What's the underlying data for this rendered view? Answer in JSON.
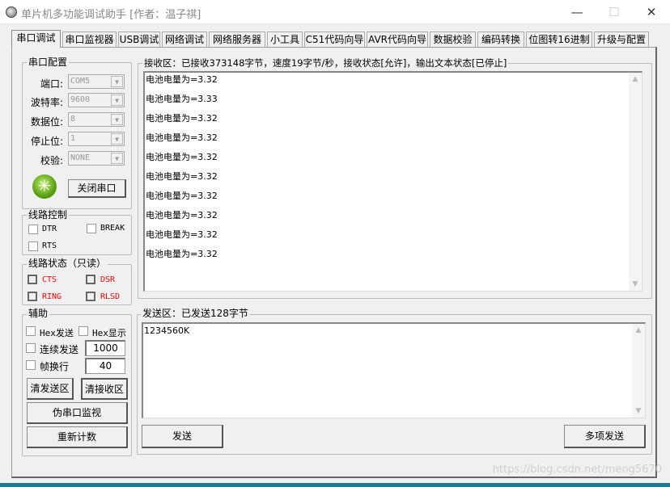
{
  "window": {
    "title": "单片机多功能调试助手 [作者：温子祺]",
    "minimize": "—",
    "maximize": "☐",
    "close": "✕"
  },
  "tabs": [
    "串口调试",
    "串口监视器",
    "USB调试",
    "网络调试",
    "网络服务器",
    "小工具",
    "C51代码向导",
    "AVR代码向导",
    "数据校验",
    "编码转换",
    "位图转16进制",
    "升级与配置"
  ],
  "serial_config": {
    "title": "串口配置",
    "port_label": "端口:",
    "port": "COM5",
    "baud_label": "波特率:",
    "baud": "9600",
    "data_label": "数据位:",
    "data_bits": "8",
    "stop_label": "停止位:",
    "stop_bits": "1",
    "parity_label": "校验:",
    "parity": "NONE",
    "close_button": "关闭串口",
    "status_color": "#5aa012"
  },
  "line_control": {
    "title": "线路控制",
    "dtr": "DTR",
    "break": "BREAK",
    "rts": "RTS"
  },
  "line_status": {
    "title": "线路状态（只读）",
    "cts": "CTS",
    "dsr": "DSR",
    "ring": "RING",
    "rlsd": "RLSD"
  },
  "assist": {
    "title": "辅助",
    "hex_send": "Hex发送",
    "hex_display": "Hex显示",
    "continuous_send": "连续发送",
    "interval": "1000",
    "frame_newline": "帧换行",
    "frame_value": "40",
    "clear_send": "清发送区",
    "clear_receive": "清接收区",
    "pseudo_monitor": "伪串口监视",
    "recount": "重新计数"
  },
  "receive": {
    "title": "接收区：已接收373148字节，速度19字节/秒，接收状态[允许]，输出文本状态[已停止]",
    "lines": [
      "电池电量为=3.32",
      "电池电量为=3.33",
      "电池电量为=3.32",
      "电池电量为=3.32",
      "电池电量为=3.32",
      "电池电量为=3.32",
      "电池电量为=3.32",
      "电池电量为=3.32",
      "电池电量为=3.32",
      "电池电量为=3.32"
    ]
  },
  "send": {
    "title": "发送区：已发送128字节",
    "content": "1234560K",
    "send_button": "发送",
    "multi_send_button": "多项发送"
  },
  "watermark": "https://blog.csdn.net/meng5670"
}
